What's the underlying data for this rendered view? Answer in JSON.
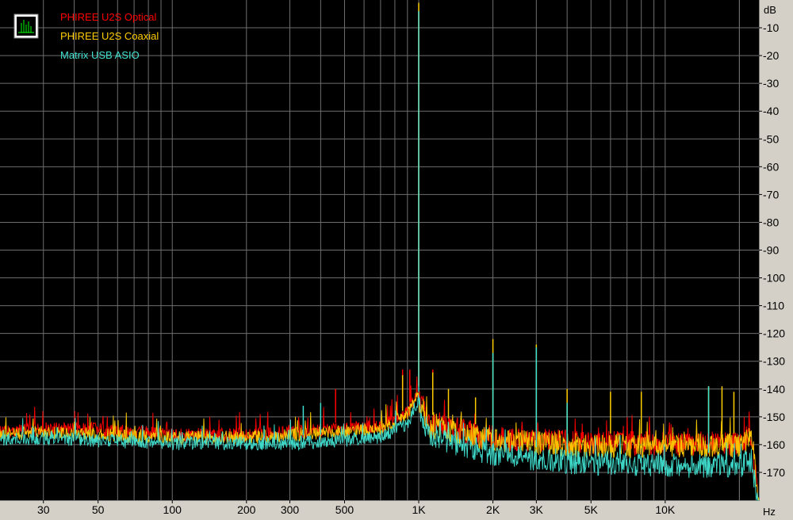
{
  "chart_data": {
    "type": "line",
    "title": "",
    "xlabel": "Hz",
    "ylabel": "dB",
    "x_scale": "log",
    "xlim": [
      20,
      24000
    ],
    "ylim": [
      -180,
      0
    ],
    "grid": true,
    "legend_placement": "top-left",
    "x_ticks": [
      {
        "value": 30,
        "label": "30"
      },
      {
        "value": 50,
        "label": "50"
      },
      {
        "value": 100,
        "label": "100"
      },
      {
        "value": 200,
        "label": "200"
      },
      {
        "value": 300,
        "label": "300"
      },
      {
        "value": 500,
        "label": "500"
      },
      {
        "value": 1000,
        "label": "1K"
      },
      {
        "value": 2000,
        "label": "2K"
      },
      {
        "value": 3000,
        "label": "3K"
      },
      {
        "value": 5000,
        "label": "5K"
      },
      {
        "value": 10000,
        "label": "10K"
      }
    ],
    "y_ticks": [
      -10,
      -20,
      -30,
      -40,
      -50,
      -60,
      -70,
      -80,
      -90,
      -100,
      -110,
      -120,
      -130,
      -140,
      -150,
      -160,
      -170
    ],
    "series": [
      {
        "name": "PHIREE U2S Optical",
        "color": "#ff0000",
        "x": [
          20,
          30,
          50,
          100,
          200,
          300,
          500,
          700,
          900,
          1000,
          1100,
          2000,
          3000,
          5000,
          10000,
          20000,
          22500,
          24000
        ],
        "y": [
          -153,
          -152,
          -152,
          -154,
          -154,
          -153,
          -152,
          -151,
          -146,
          -139,
          -148,
          -153,
          -154,
          -155,
          -155,
          -155,
          -152,
          -180
        ],
        "peaks": [
          {
            "x": 1000,
            "y": -4
          },
          {
            "x": 460,
            "y": -140
          },
          {
            "x": 860,
            "y": -133
          },
          {
            "x": 920,
            "y": -133
          },
          {
            "x": 1140,
            "y": -133
          }
        ]
      },
      {
        "name": "PHIREE U2S Coaxial",
        "color": "#ffcc00",
        "x": [
          20,
          30,
          50,
          100,
          200,
          300,
          500,
          700,
          900,
          1000,
          1100,
          2000,
          3000,
          5000,
          10000,
          20000,
          22500,
          24000
        ],
        "y": [
          -154,
          -153,
          -154,
          -155,
          -155,
          -154,
          -153,
          -152,
          -147,
          -139,
          -149,
          -154,
          -155,
          -156,
          -156,
          -156,
          -153,
          -180
        ],
        "peaks": [
          {
            "x": 1000,
            "y": -1
          },
          {
            "x": 860,
            "y": -135
          },
          {
            "x": 1140,
            "y": -134
          },
          {
            "x": 1320,
            "y": -140
          },
          {
            "x": 1700,
            "y": -143
          },
          {
            "x": 2000,
            "y": -122
          },
          {
            "x": 3000,
            "y": -124
          },
          {
            "x": 4000,
            "y": -140
          },
          {
            "x": 6000,
            "y": -141
          },
          {
            "x": 8000,
            "y": -141
          },
          {
            "x": 15000,
            "y": -139
          },
          {
            "x": 17000,
            "y": -139
          },
          {
            "x": 19000,
            "y": -141
          }
        ]
      },
      {
        "name": "Matrix USB ASIO",
        "color": "#40e0d0",
        "x": [
          20,
          30,
          50,
          100,
          200,
          300,
          500,
          700,
          900,
          1000,
          1100,
          2000,
          3000,
          5000,
          10000,
          20000,
          22500,
          24000
        ],
        "y": [
          -156,
          -155,
          -156,
          -157,
          -157,
          -157,
          -156,
          -155,
          -150,
          -141,
          -152,
          -159,
          -161,
          -162,
          -163,
          -163,
          -161,
          -180
        ],
        "peaks": [
          {
            "x": 1000,
            "y": -4
          },
          {
            "x": 340,
            "y": -146
          },
          {
            "x": 400,
            "y": -145
          },
          {
            "x": 2000,
            "y": -127
          },
          {
            "x": 3000,
            "y": -125
          },
          {
            "x": 4000,
            "y": -145
          },
          {
            "x": 15000,
            "y": -139
          }
        ]
      }
    ]
  }
}
